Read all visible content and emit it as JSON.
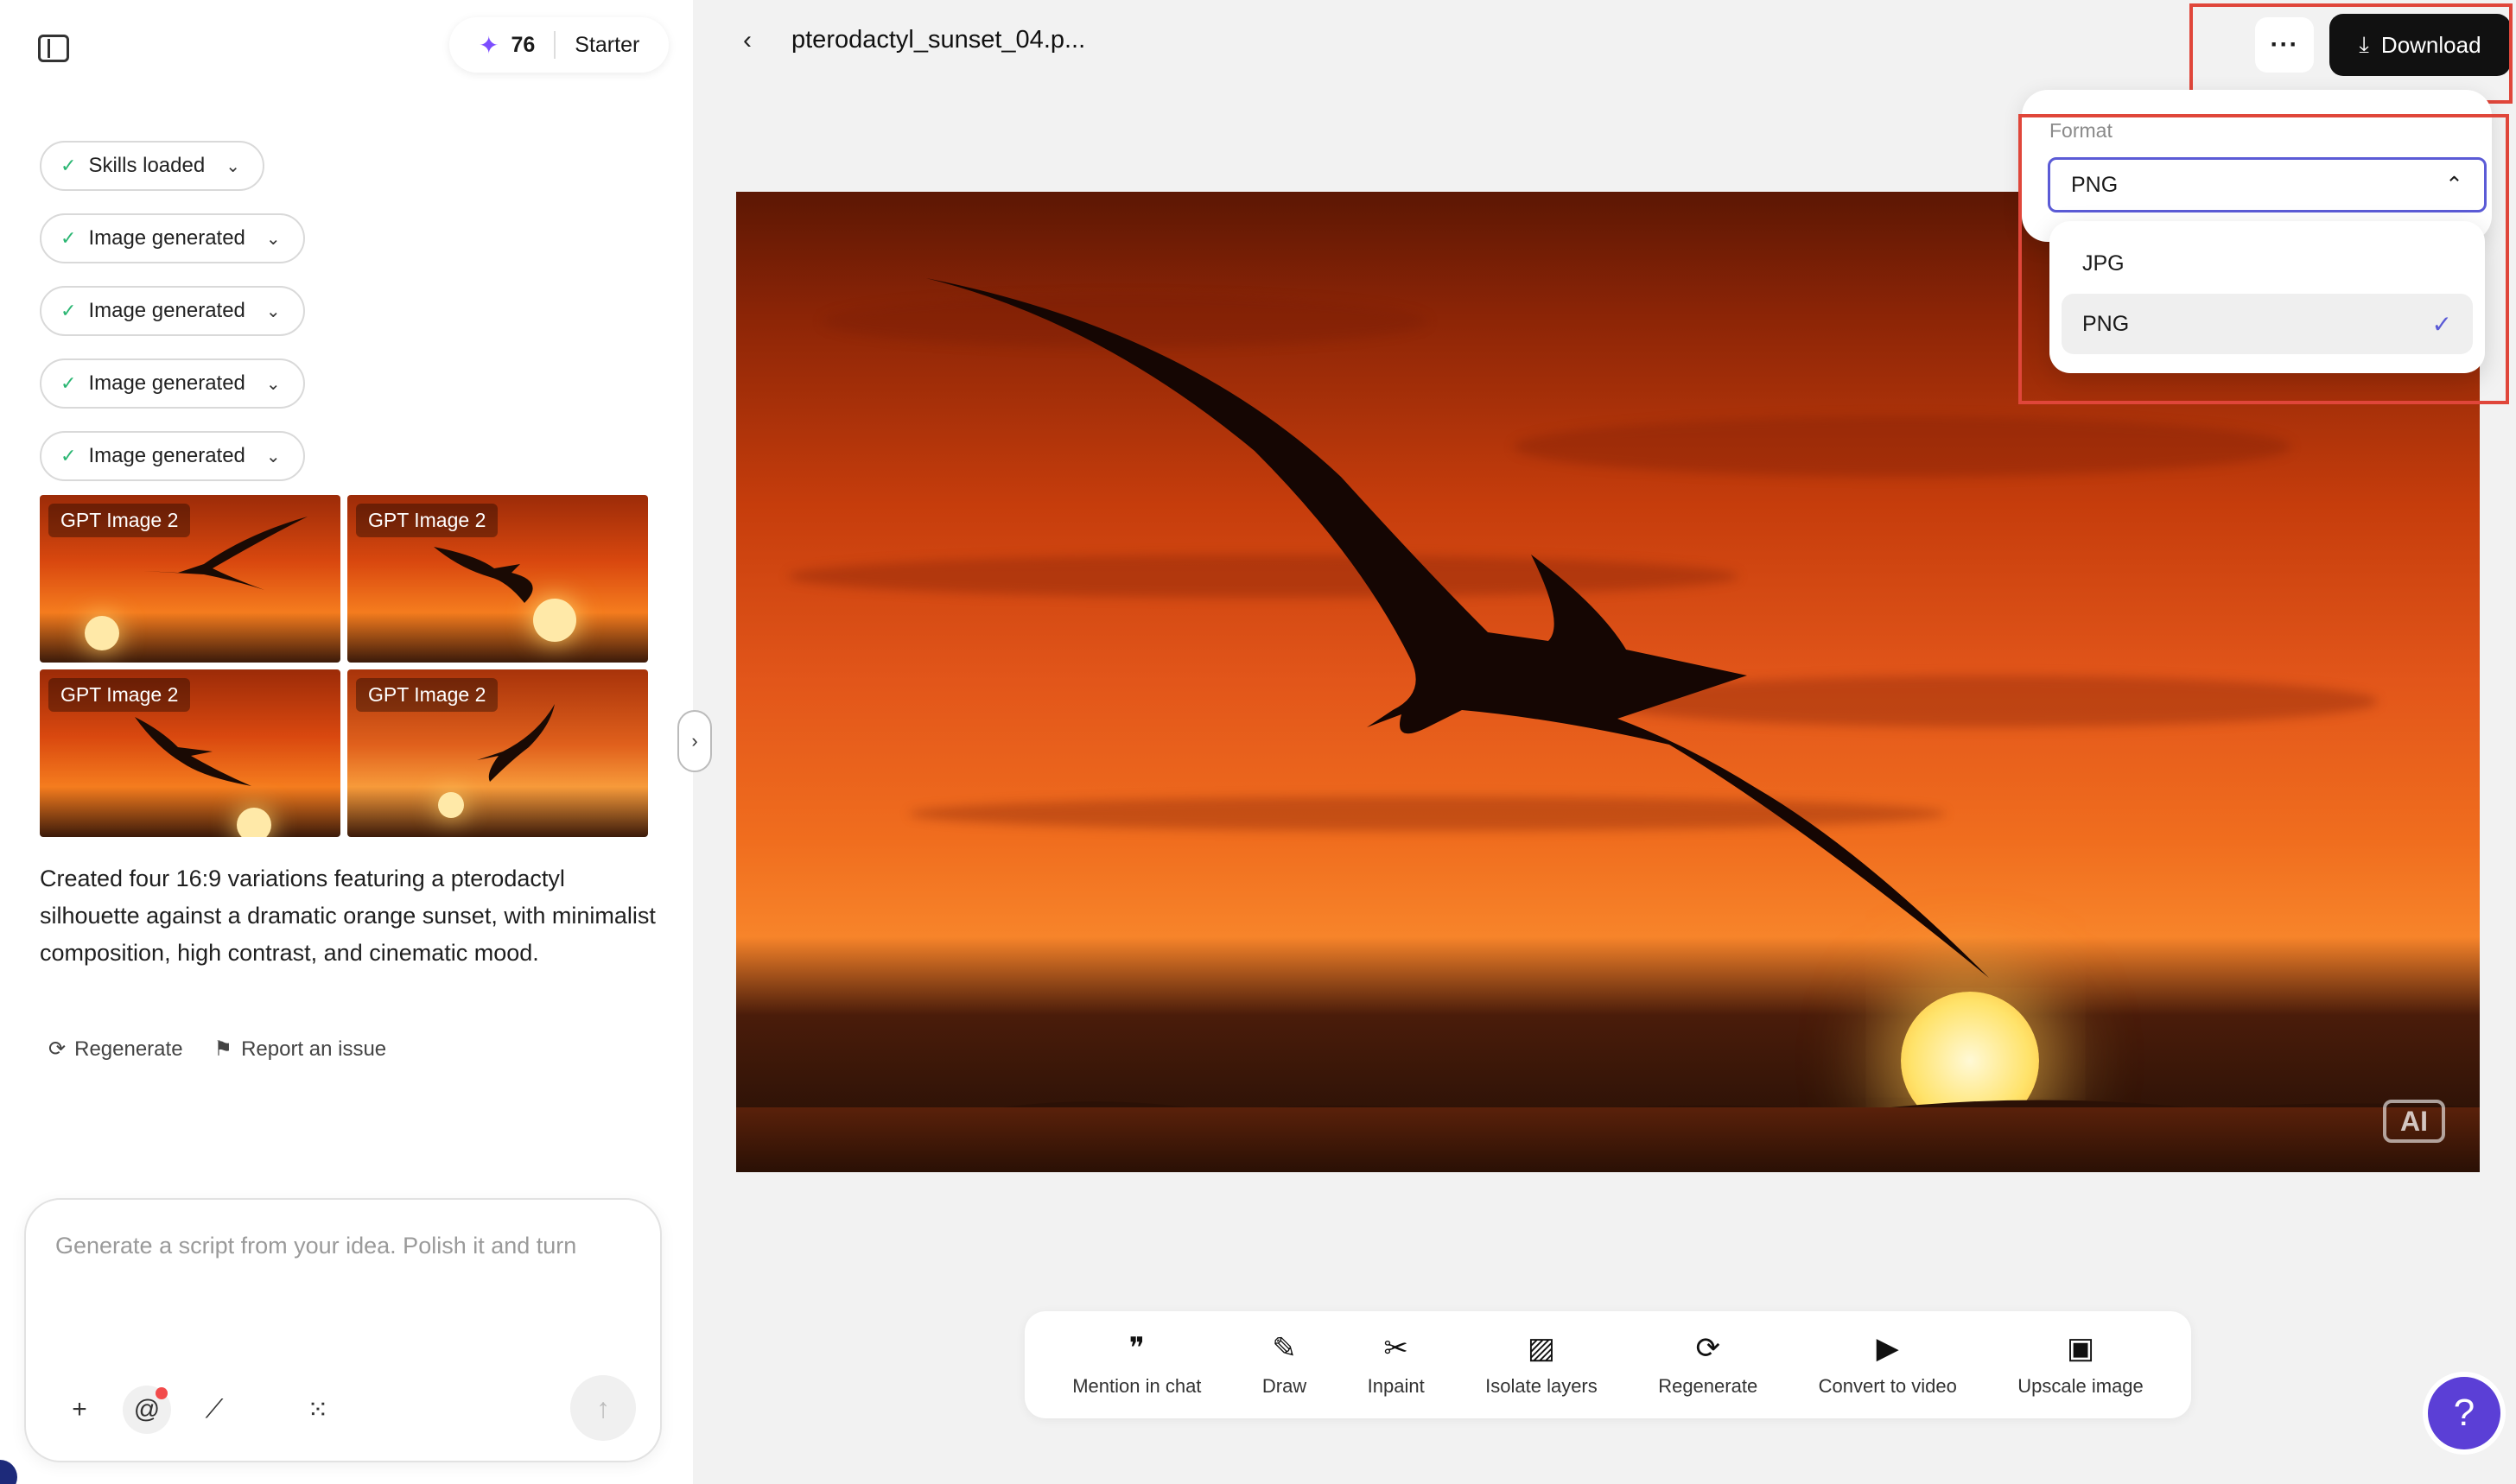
{
  "credits": {
    "count": "76",
    "plan": "Starter",
    "spark_icon": "sparkle-icon"
  },
  "steps": [
    {
      "label": "Skills loaded"
    },
    {
      "label": "Image generated"
    },
    {
      "label": "Image generated"
    },
    {
      "label": "Image generated"
    },
    {
      "label": "Image generated"
    }
  ],
  "thumbnails": [
    {
      "label": "GPT Image 2"
    },
    {
      "label": "GPT Image 2"
    },
    {
      "label": "GPT Image 2"
    },
    {
      "label": "GPT Image 2"
    }
  ],
  "reply": {
    "text": "Created four 16:9 variations featuring a pterodactyl silhouette against a dramatic orange sunset, with minimalist composition, high contrast, and cinematic mood."
  },
  "actions": {
    "regenerate": "Regenerate",
    "report": "Report an issue"
  },
  "composer": {
    "placeholder": "Generate a script from your idea. Polish it and turn"
  },
  "header": {
    "filename": "pterodactyl_sunset_04.p...",
    "download": "Download"
  },
  "format": {
    "label": "Format",
    "selected": "PNG",
    "options": [
      {
        "label": "JPG"
      },
      {
        "label": "PNG"
      }
    ]
  },
  "image": {
    "badge": "AI"
  },
  "toolbar": [
    {
      "label": "Mention in chat",
      "icon": "quote-icon"
    },
    {
      "label": "Draw",
      "icon": "brush-icon"
    },
    {
      "label": "Inpaint",
      "icon": "scissors-icon"
    },
    {
      "label": "Isolate layers",
      "icon": "image-layers-icon"
    },
    {
      "label": "Regenerate",
      "icon": "refresh-icon"
    },
    {
      "label": "Convert to video",
      "icon": "video-icon"
    },
    {
      "label": "Upscale image",
      "icon": "hd-icon"
    }
  ],
  "colors": {
    "accent": "#5b5bd6",
    "help": "#5b3fd6",
    "highlight": "#e0463a"
  }
}
